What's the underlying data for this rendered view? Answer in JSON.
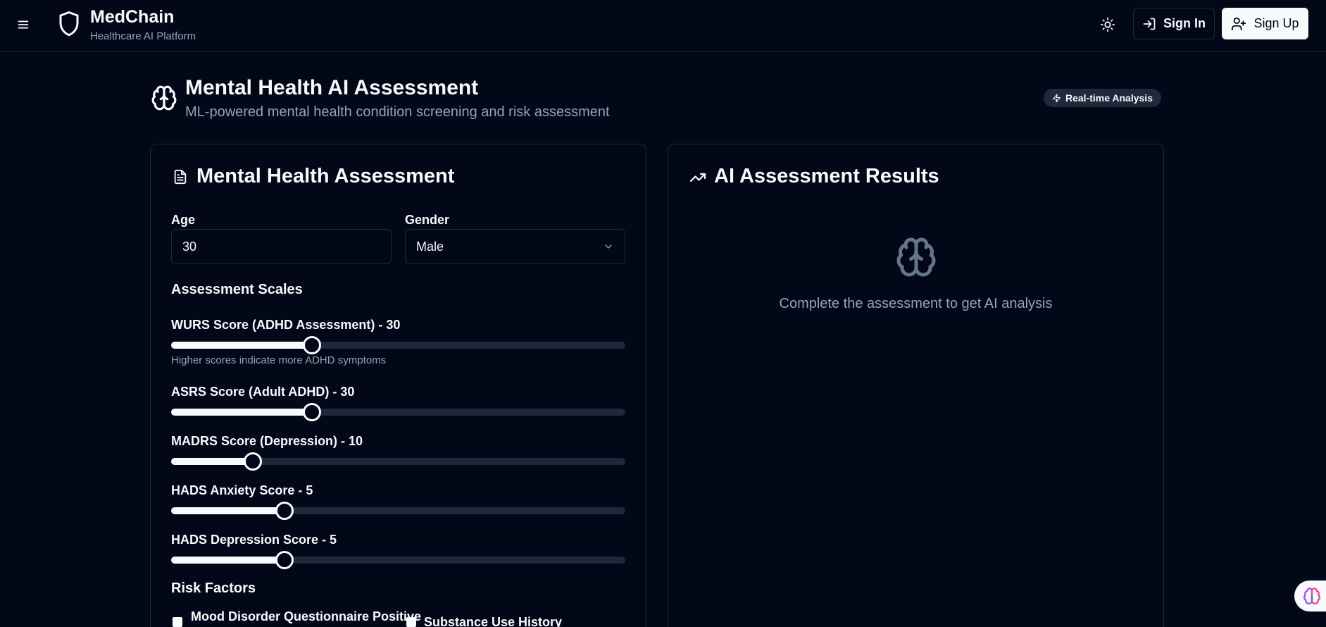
{
  "header": {
    "menu_icon": "menu-icon",
    "brand_icon": "shield-icon",
    "brand_name": "MedChain",
    "brand_subtitle": "Healthcare AI Platform",
    "theme_icon": "sun-icon",
    "sign_in_label": "Sign In",
    "sign_up_label": "Sign Up"
  },
  "page": {
    "icon": "brain-icon",
    "title": "Mental Health AI Assessment",
    "subtitle": "ML-powered mental health condition screening and risk assessment",
    "badge_label": "Real-time Analysis"
  },
  "assessment_form": {
    "title": "Mental Health Assessment",
    "age_label": "Age",
    "age_value": "30",
    "gender_label": "Gender",
    "gender_value": "Male",
    "scales_heading": "Assessment Scales",
    "sliders": [
      {
        "label": "WURS Score (ADHD Assessment) - 30",
        "fraction": 0.31,
        "help": "Higher scores indicate more ADHD symptoms"
      },
      {
        "label": "ASRS Score (Adult ADHD) - 30",
        "fraction": 0.31
      },
      {
        "label": "MADRS Score (Depression) - 10",
        "fraction": 0.18
      },
      {
        "label": "HADS Anxiety Score - 5",
        "fraction": 0.25
      },
      {
        "label": "HADS Depression Score - 5",
        "fraction": 0.25
      }
    ],
    "risk_heading": "Risk Factors",
    "risk_factors": [
      {
        "label": "Mood Disorder Questionnaire Positive",
        "checked": false
      },
      {
        "label": "Substance Use History",
        "checked": false
      }
    ]
  },
  "results": {
    "title": "AI Assessment Results",
    "title_icon": "trending-up-icon",
    "empty_icon": "brain-icon",
    "empty_message": "Complete the assessment to get AI analysis"
  },
  "colors": {
    "background": "#020817",
    "border": "#1e293b",
    "text": "#f8fafc",
    "muted": "#94a3b8"
  }
}
